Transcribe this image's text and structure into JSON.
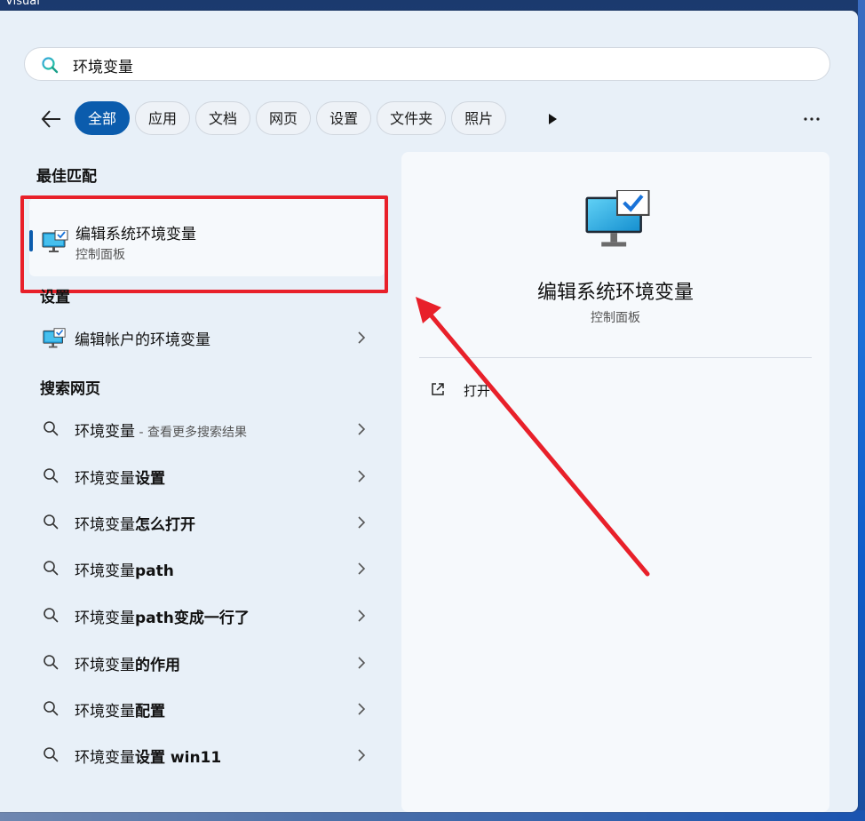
{
  "desktop": {
    "corner_text": "Visual"
  },
  "search": {
    "value": "环境变量",
    "placeholder": ""
  },
  "filters": {
    "chips": [
      {
        "label": "全部",
        "active": true
      },
      {
        "label": "应用"
      },
      {
        "label": "文档"
      },
      {
        "label": "网页"
      },
      {
        "label": "设置"
      },
      {
        "label": "文件夹"
      },
      {
        "label": "照片"
      }
    ]
  },
  "best_match": {
    "section_title": "最佳匹配",
    "title": "编辑系统环境变量",
    "subtitle": "控制面板",
    "icon": "monitor-check-icon"
  },
  "settings": {
    "section_title": "设置",
    "items": [
      {
        "label": "编辑帐户的环境变量",
        "icon": "monitor-check-icon"
      }
    ]
  },
  "web": {
    "section_title": "搜索网页",
    "items": [
      {
        "prefix": "环境变量",
        "hint": " - 查看更多搜索结果"
      },
      {
        "prefix": "环境变量",
        "suffix": "设置"
      },
      {
        "prefix": "环境变量",
        "suffix": "怎么打开"
      },
      {
        "prefix": "环境变量",
        "suffix": "path"
      },
      {
        "prefix": "环境变量",
        "suffix": "path变成一行了"
      },
      {
        "prefix": "环境变量",
        "suffix": "的作用"
      },
      {
        "prefix": "环境变量",
        "suffix": "配置"
      },
      {
        "prefix": "环境变量",
        "suffix": "设置 win11"
      }
    ]
  },
  "preview": {
    "title": "编辑系统环境变量",
    "subtitle": "控制面板",
    "open_label": "打开",
    "icon": "monitor-check-icon"
  },
  "colors": {
    "accent": "#0b5cad",
    "annotation": "#e8202a"
  }
}
